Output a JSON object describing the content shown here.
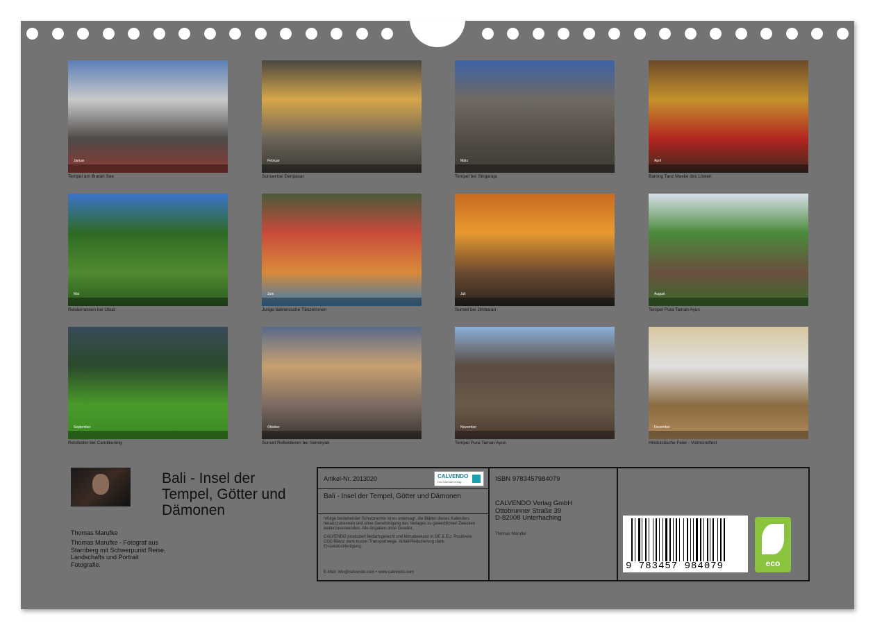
{
  "months": [
    {
      "label": "Januar",
      "caption": "Tempel am Bratan See",
      "colors": [
        "#5b7fb8",
        "#c9c9c9",
        "#4e4a48",
        "#8c3a34"
      ]
    },
    {
      "label": "Februar",
      "caption": "Sunset bei Denpasar",
      "colors": [
        "#4a4740",
        "#d7a64a",
        "#6a6458",
        "#3c3934"
      ]
    },
    {
      "label": "März",
      "caption": "Tempel bei Singaraja",
      "colors": [
        "#3d62a8",
        "#6f6a62",
        "#524c45",
        "#3e3a35"
      ]
    },
    {
      "label": "April",
      "caption": "Barong Tanz Maske des Löwen",
      "colors": [
        "#6b4a2a",
        "#c4912c",
        "#b2241f",
        "#3a2a1f"
      ]
    },
    {
      "label": "Mai",
      "caption": "Reisterrassen bei Ubud",
      "colors": [
        "#3a73c9",
        "#2f6a25",
        "#4f8a2f",
        "#2a5a20"
      ]
    },
    {
      "label": "Juni",
      "caption": "Junge balinesische Tänzerinnen",
      "colors": [
        "#4a5a3a",
        "#c84a3a",
        "#d98a3a",
        "#3a7ab0"
      ]
    },
    {
      "label": "Juli",
      "caption": "Sunset bei Jimbaran",
      "colors": [
        "#c86a20",
        "#e89a30",
        "#6a4a30",
        "#2a2420"
      ]
    },
    {
      "label": "August",
      "caption": "Tempel Pura Taman Ayun",
      "colors": [
        "#d8e0ea",
        "#4a8a3a",
        "#6a5040",
        "#3a6a2a"
      ]
    },
    {
      "label": "September",
      "caption": "Reisfelder bei Candikuning",
      "colors": [
        "#3a4a5a",
        "#2a4a2a",
        "#4a9a2a",
        "#3a8a25"
      ]
    },
    {
      "label": "Oktober",
      "caption": "Sunset Reflektieren bei Seminyak",
      "colors": [
        "#5a6a8a",
        "#c8a070",
        "#7a6a60",
        "#3a3430"
      ]
    },
    {
      "label": "November",
      "caption": "Tempel Pura Taman Ayun",
      "colors": [
        "#8ab0d8",
        "#5a4a40",
        "#6a5a4a",
        "#4a3a30"
      ]
    },
    {
      "label": "Dezember",
      "caption": "Hinduistische Feier - Vollmondfest",
      "colors": [
        "#d8c8a0",
        "#e0e0e0",
        "#8a6a40",
        "#b08a5a"
      ]
    }
  ],
  "calendar_title": "Bali - Insel der Tempel, Götter und Dämonen",
  "author": {
    "name": "Thomas Marufke",
    "bio": "Thomas Marufke - Fotograf aus Starnberg mit Schwerpunkt Reise, Landschafts und Portrait Fotografie."
  },
  "info": {
    "article": "Artikel-Nr. 2013020",
    "logo_name": "CALVENDO",
    "logo_sub": "Der Kalenderverlag",
    "cal_title": "Bali - Insel der Tempel, Götter und Dämonen",
    "note1": "Infolge bestehender Schutzrechte ist es untersagt, die Blätter dieses Kalenders herauszutrennen und ohne Genehmigung des Verlages zu gewerblichen Zwecken weiterzuverwenden. Alle Angaben ohne Gewähr.",
    "note2": "CALVENDO produziert bedarfsgerecht und klimabewusst in DE & EU. Positivere CO2-Bilanz dank kurzer Transportwege. Abfall-Reduzierung dank Einzelstückfertigung.",
    "email": "E-Mail: info@calvendo.com • www.calvendo.com",
    "isbn": "ISBN 9783457984079",
    "publisher_name": "CALVENDO Verlag GmbH",
    "publisher_street": "Ottobrunner Straße 39",
    "publisher_city": "D-82008 Unterhaching",
    "author_small": "Thomas Marufke",
    "barcode_number": "9 783457 984079",
    "eco_label": "eco"
  }
}
